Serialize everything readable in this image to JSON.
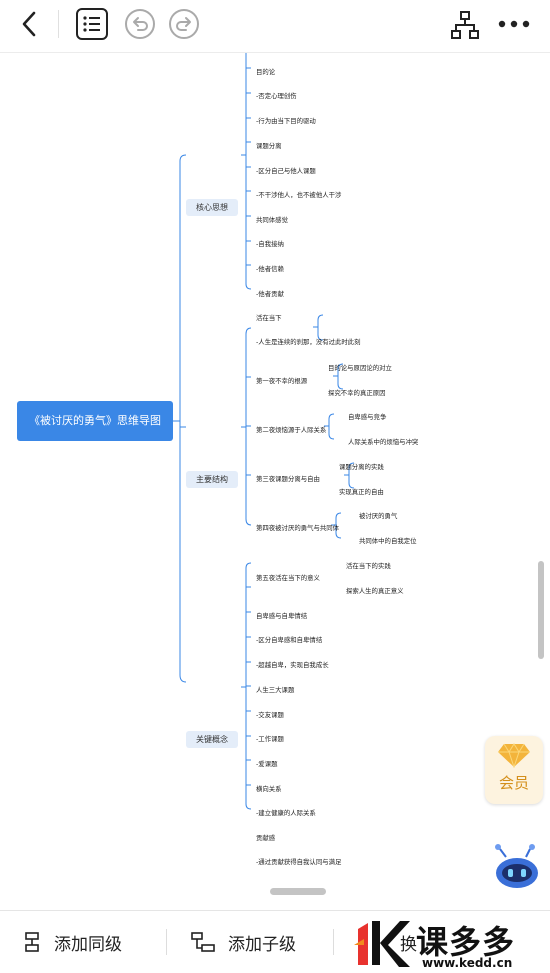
{
  "toolbar": {
    "back_icon": "chevron-left-icon",
    "outline_icon": "list-outline-icon",
    "undo_icon": "undo-icon",
    "redo_icon": "redo-icon",
    "structure_icon": "org-chart-icon",
    "more_icon": "more-dots-icon"
  },
  "map": {
    "root": "《被讨厌的勇气》思维导图",
    "cat1": {
      "label": "核心思想",
      "leaves": [
        "目的论",
        "-否定心理创伤",
        "-行为由当下目的驱动",
        "课题分离",
        "-区分自己与他人课题",
        "-不干涉他人，也不被他人干涉",
        "共同体感觉",
        "-自我接纳",
        "-他者信赖",
        "-他者贡献",
        "活在当下",
        "-人生是连续的刹那，没有过此时此刻"
      ]
    },
    "cat2": {
      "label": "主要结构",
      "chapters": [
        {
          "label": "第一夜不幸的根源",
          "items": [
            "目的论与原因论的对立",
            "探究不幸的真正原因"
          ]
        },
        {
          "label": "第二夜烦恼源于人际关系",
          "items": [
            "自卑感与竞争",
            "人际关系中的烦恼与冲突"
          ]
        },
        {
          "label": "第三夜课题分离与自由",
          "items": [
            "课题分离的实践",
            "实现真正的自由"
          ]
        },
        {
          "label": "第四夜被讨厌的勇气与共同体",
          "items": [
            "被讨厌的勇气",
            "共同体中的自我定位"
          ]
        },
        {
          "label": "第五夜活在当下的意义",
          "items": [
            "活在当下的实践",
            "探索人生的真正意义"
          ]
        }
      ]
    },
    "cat3": {
      "label": "关键概念",
      "leaves": [
        "自卑感与自卑情结",
        "-区分自卑感和自卑情结",
        "-超越自卑，实现自我成长",
        "人生三大课题",
        "-交友课题",
        "-工作课题",
        "-爱课题",
        "横向关系",
        "-建立健康的人际关系",
        "贡献感",
        "-通过贡献获得自我认同与满足"
      ]
    }
  },
  "vip": {
    "label": "会员",
    "icon": "diamond-icon"
  },
  "assistant_icon": "robot-assistant-icon",
  "bottom_bar": {
    "add_sibling": "添加同级",
    "add_child": "添加子级",
    "swap": "换",
    "watermark": "课多多",
    "watermark_url": "www.kedd.cn"
  }
}
